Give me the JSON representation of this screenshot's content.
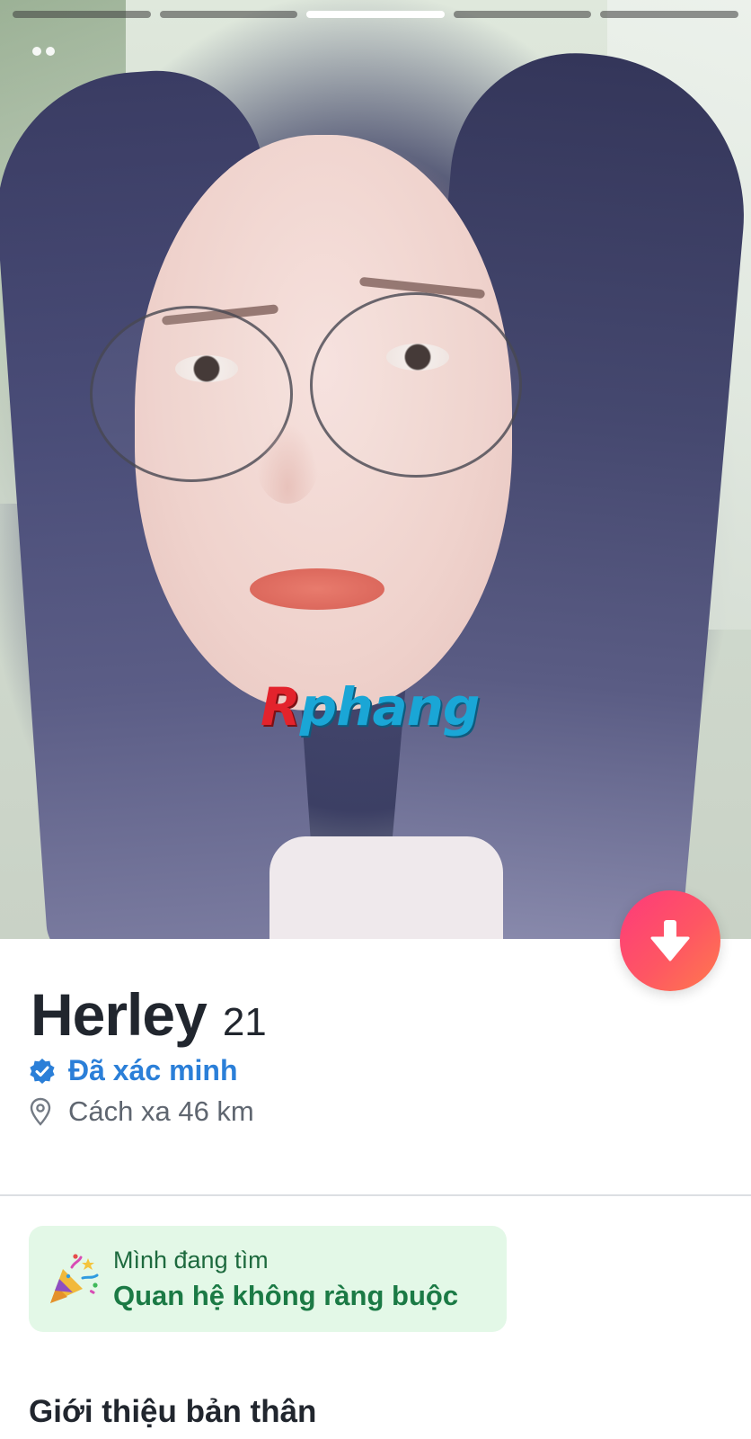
{
  "photos": {
    "count": 5,
    "active_index": 2
  },
  "watermark": {
    "first": "R",
    "rest": "phang"
  },
  "profile": {
    "name": "Herley",
    "age": "21",
    "verified_label": "Đã xác minh",
    "distance_label": "Cách xa 46 km"
  },
  "looking_for": {
    "label": "Mình đang tìm",
    "value": "Quan hệ không ràng buộc"
  },
  "sections": {
    "about_title": "Giới thiệu bản thân"
  },
  "colors": {
    "accent_gradient_start": "#fd3a7b",
    "accent_gradient_end": "#ff7a4d",
    "verified_blue": "#2b7fd8",
    "looking_bg": "#e3f8e7",
    "looking_text": "#1b7a45"
  },
  "icons": {
    "collapse": "arrow-down-icon",
    "verified": "verified-badge-icon",
    "location": "location-pin-icon",
    "looking": "party-popper-icon",
    "photo_menu": "dots-icon"
  }
}
